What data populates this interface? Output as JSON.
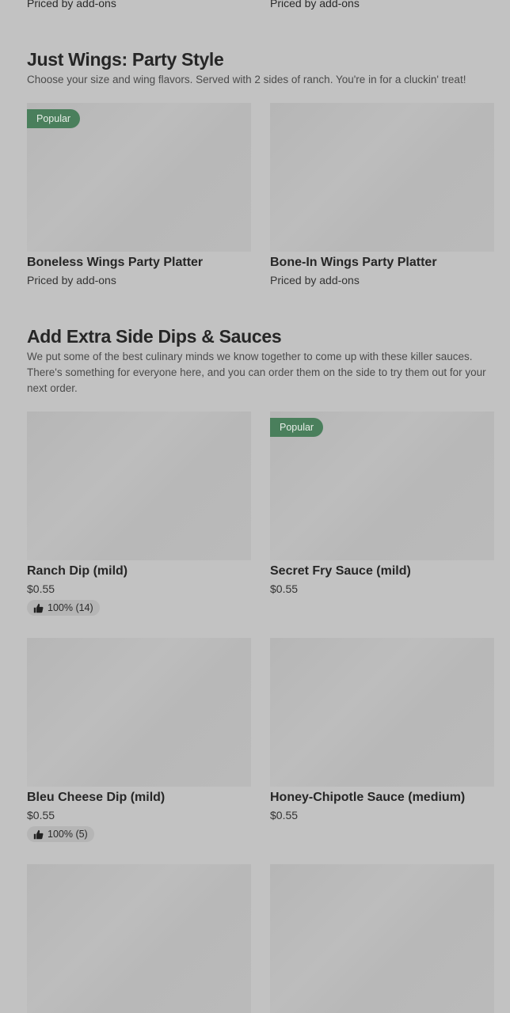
{
  "top_row": {
    "left_price": "Priced by add-ons",
    "right_price": "Priced by add-ons"
  },
  "wings": {
    "title": "Just Wings: Party Style",
    "description": "Choose your size and wing flavors. Served with 2 sides of ranch. You're in for a cluckin' treat!",
    "items": [
      {
        "badge": "Popular",
        "name": "Boneless Wings Party Platter",
        "price": "Priced by add-ons"
      },
      {
        "name": "Bone-In Wings Party Platter",
        "price": "Priced by add-ons"
      }
    ]
  },
  "dips": {
    "title": "Add Extra Side Dips & Sauces",
    "description": "We put some of the best culinary minds we know together to come up with these killer sauces. There's something for everyone here, and you can order them on the side to try them out for your next order.",
    "items": [
      {
        "name": "Ranch Dip (mild)",
        "price": "$0.55",
        "rating": "100% (14)"
      },
      {
        "badge": "Popular",
        "name": "Secret Fry Sauce (mild)",
        "price": "$0.55"
      },
      {
        "name": "Bleu Cheese Dip (mild)",
        "price": "$0.55",
        "rating": "100% (5)"
      },
      {
        "name": "Honey-Chipotle Sauce (medium)",
        "price": "$0.55"
      }
    ]
  }
}
